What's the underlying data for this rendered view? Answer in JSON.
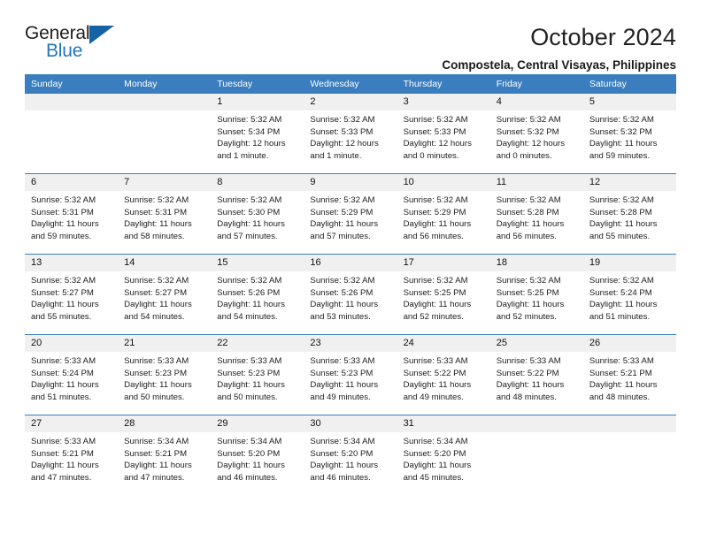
{
  "brand": {
    "name_top": "General",
    "name_bottom": "Blue",
    "triangle_color": "#1464a5",
    "blue_color": "#2176bd"
  },
  "header": {
    "title": "October 2024",
    "subtitle": "Compostela, Central Visayas, Philippines"
  },
  "calendar": {
    "header_bg": "#3a7ebf",
    "daynum_bg": "#f0f0f0",
    "weekday_headers": [
      "Sunday",
      "Monday",
      "Tuesday",
      "Wednesday",
      "Thursday",
      "Friday",
      "Saturday"
    ],
    "weeks": [
      [
        {
          "day": "",
          "sunrise": "",
          "sunset": "",
          "daylight": ""
        },
        {
          "day": "",
          "sunrise": "",
          "sunset": "",
          "daylight": ""
        },
        {
          "day": "1",
          "sunrise": "Sunrise: 5:32 AM",
          "sunset": "Sunset: 5:34 PM",
          "daylight": "Daylight: 12 hours and 1 minute."
        },
        {
          "day": "2",
          "sunrise": "Sunrise: 5:32 AM",
          "sunset": "Sunset: 5:33 PM",
          "daylight": "Daylight: 12 hours and 1 minute."
        },
        {
          "day": "3",
          "sunrise": "Sunrise: 5:32 AM",
          "sunset": "Sunset: 5:33 PM",
          "daylight": "Daylight: 12 hours and 0 minutes."
        },
        {
          "day": "4",
          "sunrise": "Sunrise: 5:32 AM",
          "sunset": "Sunset: 5:32 PM",
          "daylight": "Daylight: 12 hours and 0 minutes."
        },
        {
          "day": "5",
          "sunrise": "Sunrise: 5:32 AM",
          "sunset": "Sunset: 5:32 PM",
          "daylight": "Daylight: 11 hours and 59 minutes."
        }
      ],
      [
        {
          "day": "6",
          "sunrise": "Sunrise: 5:32 AM",
          "sunset": "Sunset: 5:31 PM",
          "daylight": "Daylight: 11 hours and 59 minutes."
        },
        {
          "day": "7",
          "sunrise": "Sunrise: 5:32 AM",
          "sunset": "Sunset: 5:31 PM",
          "daylight": "Daylight: 11 hours and 58 minutes."
        },
        {
          "day": "8",
          "sunrise": "Sunrise: 5:32 AM",
          "sunset": "Sunset: 5:30 PM",
          "daylight": "Daylight: 11 hours and 57 minutes."
        },
        {
          "day": "9",
          "sunrise": "Sunrise: 5:32 AM",
          "sunset": "Sunset: 5:29 PM",
          "daylight": "Daylight: 11 hours and 57 minutes."
        },
        {
          "day": "10",
          "sunrise": "Sunrise: 5:32 AM",
          "sunset": "Sunset: 5:29 PM",
          "daylight": "Daylight: 11 hours and 56 minutes."
        },
        {
          "day": "11",
          "sunrise": "Sunrise: 5:32 AM",
          "sunset": "Sunset: 5:28 PM",
          "daylight": "Daylight: 11 hours and 56 minutes."
        },
        {
          "day": "12",
          "sunrise": "Sunrise: 5:32 AM",
          "sunset": "Sunset: 5:28 PM",
          "daylight": "Daylight: 11 hours and 55 minutes."
        }
      ],
      [
        {
          "day": "13",
          "sunrise": "Sunrise: 5:32 AM",
          "sunset": "Sunset: 5:27 PM",
          "daylight": "Daylight: 11 hours and 55 minutes."
        },
        {
          "day": "14",
          "sunrise": "Sunrise: 5:32 AM",
          "sunset": "Sunset: 5:27 PM",
          "daylight": "Daylight: 11 hours and 54 minutes."
        },
        {
          "day": "15",
          "sunrise": "Sunrise: 5:32 AM",
          "sunset": "Sunset: 5:26 PM",
          "daylight": "Daylight: 11 hours and 54 minutes."
        },
        {
          "day": "16",
          "sunrise": "Sunrise: 5:32 AM",
          "sunset": "Sunset: 5:26 PM",
          "daylight": "Daylight: 11 hours and 53 minutes."
        },
        {
          "day": "17",
          "sunrise": "Sunrise: 5:32 AM",
          "sunset": "Sunset: 5:25 PM",
          "daylight": "Daylight: 11 hours and 52 minutes."
        },
        {
          "day": "18",
          "sunrise": "Sunrise: 5:32 AM",
          "sunset": "Sunset: 5:25 PM",
          "daylight": "Daylight: 11 hours and 52 minutes."
        },
        {
          "day": "19",
          "sunrise": "Sunrise: 5:32 AM",
          "sunset": "Sunset: 5:24 PM",
          "daylight": "Daylight: 11 hours and 51 minutes."
        }
      ],
      [
        {
          "day": "20",
          "sunrise": "Sunrise: 5:33 AM",
          "sunset": "Sunset: 5:24 PM",
          "daylight": "Daylight: 11 hours and 51 minutes."
        },
        {
          "day": "21",
          "sunrise": "Sunrise: 5:33 AM",
          "sunset": "Sunset: 5:23 PM",
          "daylight": "Daylight: 11 hours and 50 minutes."
        },
        {
          "day": "22",
          "sunrise": "Sunrise: 5:33 AM",
          "sunset": "Sunset: 5:23 PM",
          "daylight": "Daylight: 11 hours and 50 minutes."
        },
        {
          "day": "23",
          "sunrise": "Sunrise: 5:33 AM",
          "sunset": "Sunset: 5:23 PM",
          "daylight": "Daylight: 11 hours and 49 minutes."
        },
        {
          "day": "24",
          "sunrise": "Sunrise: 5:33 AM",
          "sunset": "Sunset: 5:22 PM",
          "daylight": "Daylight: 11 hours and 49 minutes."
        },
        {
          "day": "25",
          "sunrise": "Sunrise: 5:33 AM",
          "sunset": "Sunset: 5:22 PM",
          "daylight": "Daylight: 11 hours and 48 minutes."
        },
        {
          "day": "26",
          "sunrise": "Sunrise: 5:33 AM",
          "sunset": "Sunset: 5:21 PM",
          "daylight": "Daylight: 11 hours and 48 minutes."
        }
      ],
      [
        {
          "day": "27",
          "sunrise": "Sunrise: 5:33 AM",
          "sunset": "Sunset: 5:21 PM",
          "daylight": "Daylight: 11 hours and 47 minutes."
        },
        {
          "day": "28",
          "sunrise": "Sunrise: 5:34 AM",
          "sunset": "Sunset: 5:21 PM",
          "daylight": "Daylight: 11 hours and 47 minutes."
        },
        {
          "day": "29",
          "sunrise": "Sunrise: 5:34 AM",
          "sunset": "Sunset: 5:20 PM",
          "daylight": "Daylight: 11 hours and 46 minutes."
        },
        {
          "day": "30",
          "sunrise": "Sunrise: 5:34 AM",
          "sunset": "Sunset: 5:20 PM",
          "daylight": "Daylight: 11 hours and 46 minutes."
        },
        {
          "day": "31",
          "sunrise": "Sunrise: 5:34 AM",
          "sunset": "Sunset: 5:20 PM",
          "daylight": "Daylight: 11 hours and 45 minutes."
        },
        {
          "day": "",
          "sunrise": "",
          "sunset": "",
          "daylight": ""
        },
        {
          "day": "",
          "sunrise": "",
          "sunset": "",
          "daylight": ""
        }
      ]
    ]
  }
}
